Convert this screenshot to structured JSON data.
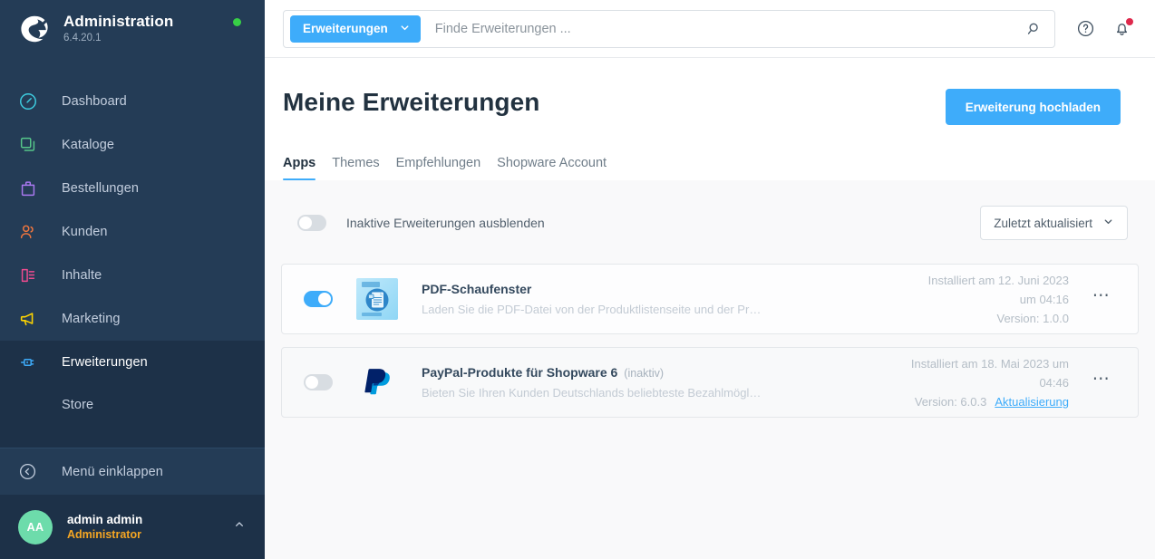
{
  "sidebar": {
    "brand": {
      "title": "Administration",
      "version": "6.4.20.1",
      "logo_icon": "shopware-logo-icon",
      "status_icon": "status-dot-online"
    },
    "items": [
      {
        "label": "Dashboard",
        "icon": "dashboard-icon",
        "color": "#3ecde0"
      },
      {
        "label": "Kataloge",
        "icon": "catalog-icon",
        "color": "#56c78a"
      },
      {
        "label": "Bestellungen",
        "icon": "orders-bag-icon",
        "color": "#a978f0"
      },
      {
        "label": "Kunden",
        "icon": "customers-icon",
        "color": "#f0763e"
      },
      {
        "label": "Inhalte",
        "icon": "content-icon",
        "color": "#ef4b8f"
      },
      {
        "label": "Marketing",
        "icon": "megaphone-icon",
        "color": "#ffd500"
      },
      {
        "label": "Erweiterungen",
        "icon": "plug-icon",
        "color": "#3eacfa"
      }
    ],
    "sub_item": {
      "label": "Store"
    },
    "collapse": {
      "label": "Menü einklappen",
      "icon": "chevron-left-circle-icon"
    },
    "user": {
      "initials": "AA",
      "name": "admin admin",
      "role": "Administrator",
      "caret_icon": "chevron-up-icon"
    }
  },
  "topbar": {
    "scope_label": "Erweiterungen",
    "scope_caret_icon": "chevron-down-icon",
    "search_placeholder": "Finde Erweiterungen ...",
    "search_value": "",
    "search_icon": "search-icon",
    "help_icon": "help-circle-icon",
    "bell_icon": "bell-icon",
    "bell_has_badge": true
  },
  "page": {
    "title": "Meine Erweiterungen",
    "upload_button": "Erweiterung hochladen",
    "tabs": [
      {
        "label": "Apps",
        "active": true
      },
      {
        "label": "Themes",
        "active": false
      },
      {
        "label": "Empfehlungen",
        "active": false
      },
      {
        "label": "Shopware Account",
        "active": false
      }
    ],
    "filters": {
      "hide_inactive_label": "Inaktive Erweiterungen ausblenden",
      "hide_inactive_on": false,
      "sort_label": "Zuletzt aktualisiert",
      "sort_caret_icon": "chevron-down-icon"
    }
  },
  "extensions": [
    {
      "name": "PDF-Schaufenster",
      "badge": "",
      "description": "Laden Sie die PDF-Datei von der Produktlistenseite und der Produktdet…",
      "icon": "pdf-document-icon",
      "enabled": true,
      "installed_line1": "Installiert am 12. Juni 2023",
      "installed_line2": "um 04:16",
      "version": "Version: 1.0.0",
      "update_link": "",
      "context_menu_icon": "ellipsis-icon"
    },
    {
      "name": "PayPal-Produkte für Shopware 6",
      "badge": "(inaktiv)",
      "description": "Bieten Sie Ihren Kunden Deutschlands beliebteste Bezahlmöglichkeiten…",
      "icon": "paypal-icon",
      "enabled": false,
      "installed_line1": "Installiert am 18. Mai 2023 um",
      "installed_line2": "04:46",
      "version": "Version: 6.0.3",
      "update_link": "Aktualisierung",
      "context_menu_icon": "ellipsis-icon"
    }
  ],
  "colors": {
    "sidebar_bg": "#243c56",
    "sidebar_active_bg": "#1d3148",
    "accent": "#3eacfa",
    "badge_red": "#de294c",
    "status_green": "#37d046",
    "role_orange": "#f5a623"
  }
}
